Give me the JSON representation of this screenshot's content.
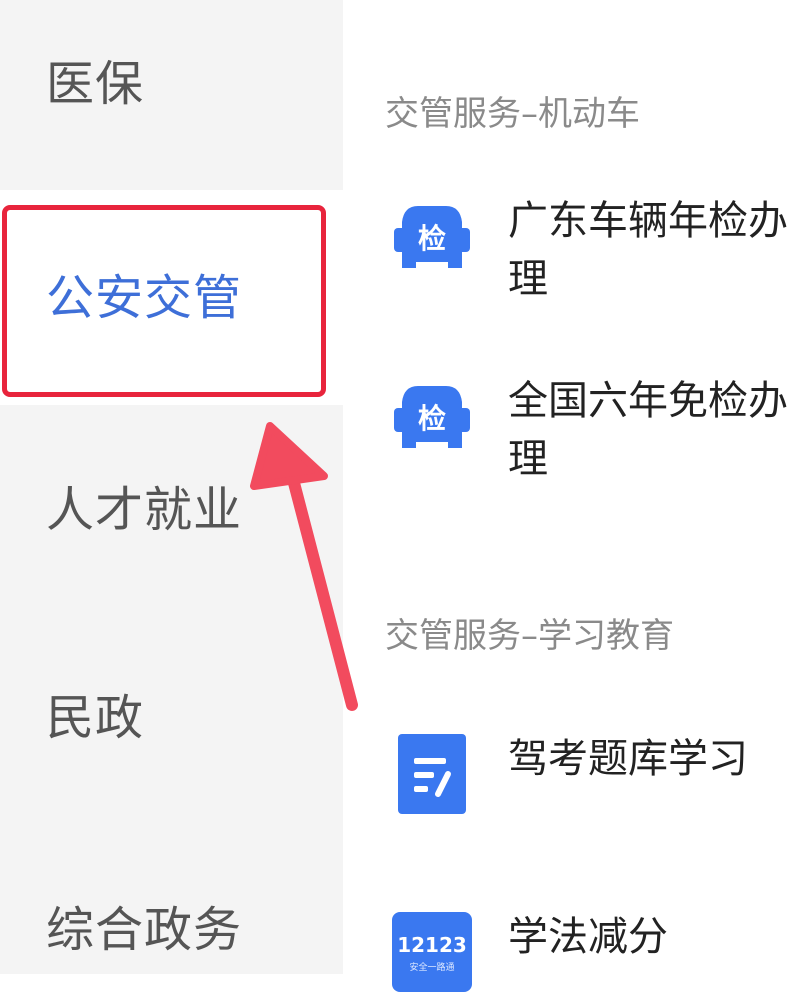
{
  "sidebar": {
    "items": [
      {
        "label": "医保"
      },
      {
        "label": "公安交管"
      },
      {
        "label": "人才就业"
      },
      {
        "label": "民政"
      },
      {
        "label": "综合政务"
      }
    ]
  },
  "sections": [
    {
      "title": "交管服务–机动车",
      "items": [
        {
          "label": "广东车辆年检办理",
          "icon": "car-inspection-icon",
          "icon_text": "检"
        },
        {
          "label": "全国六年免检办理",
          "icon": "car-inspection-icon",
          "icon_text": "检"
        }
      ]
    },
    {
      "title": "交管服务–学习教育",
      "items": [
        {
          "label": "驾考题库学习",
          "icon": "exam-question-icon"
        },
        {
          "label": "学法减分",
          "icon": "12123-app-icon",
          "icon_text": "12123",
          "icon_subtext": "安全一路通"
        }
      ]
    }
  ],
  "colors": {
    "accent": "#3e6fd8",
    "icon_blue": "#3a78f0",
    "highlight_red": "#e8243c"
  }
}
